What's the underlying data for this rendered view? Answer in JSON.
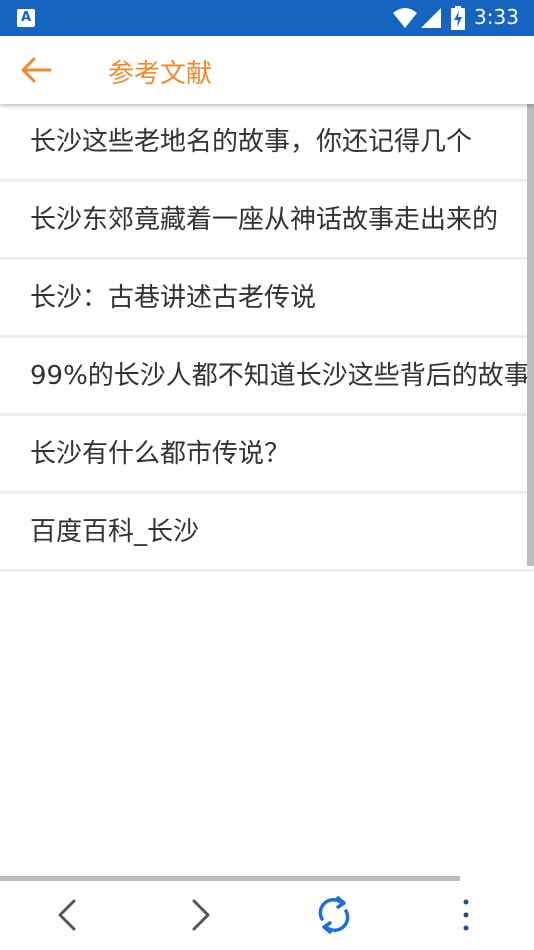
{
  "status_bar": {
    "time": "3:33",
    "app_icon_letter": "A",
    "icons": [
      "app-notification-icon",
      "wifi-icon",
      "signal-icon",
      "battery-charging-icon"
    ]
  },
  "app_bar": {
    "title": "参考文献",
    "back_icon": "arrow-left-icon",
    "accent_color": "#F08A2C"
  },
  "references": [
    {
      "label": "长沙这些老地名的故事，你还记得几个"
    },
    {
      "label": "长沙东郊竟藏着一座从神话故事走出来的"
    },
    {
      "label": "长沙：古巷讲述古老传说"
    },
    {
      "label": "99%的长沙人都不知道长沙这些背后的故事"
    },
    {
      "label": "长沙有什么都市传说？"
    },
    {
      "label": "百度百科_长沙"
    }
  ],
  "bottom_toolbar": {
    "icons": [
      "chevron-left-icon",
      "chevron-right-icon",
      "refresh-icon",
      "more-vert-icon"
    ],
    "refresh_color": "#1E6FD9"
  },
  "colors": {
    "status_bar": "#1565C0",
    "text": "#333333",
    "divider": "#EDEDED"
  }
}
